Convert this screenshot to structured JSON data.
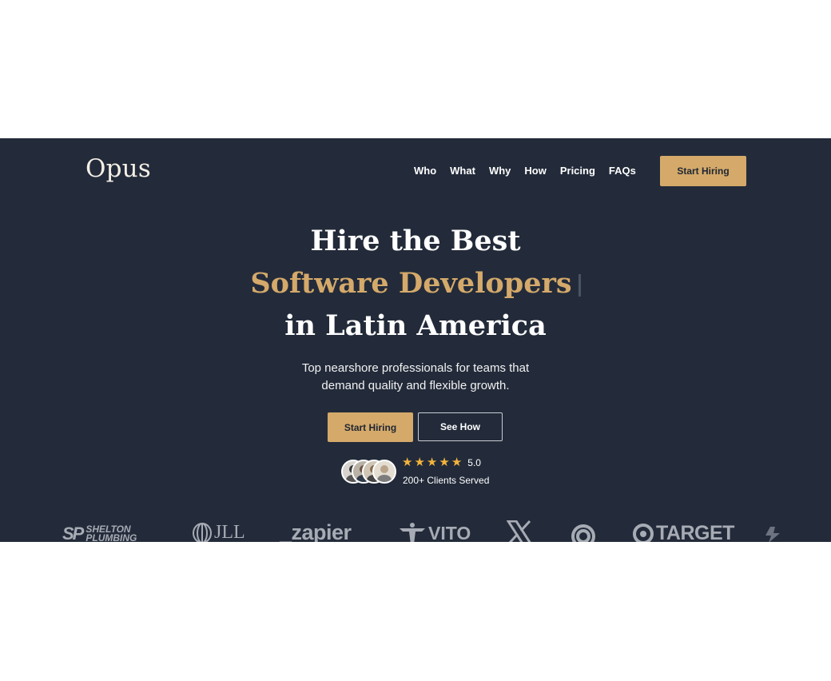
{
  "brand": {
    "name": "Opus"
  },
  "nav": {
    "items": [
      "Who",
      "What",
      "Why",
      "How",
      "Pricing",
      "FAQs"
    ],
    "cta_label": "Start Hiring"
  },
  "hero": {
    "headline_line1": "Hire the Best",
    "headline_line2": "Software Developers",
    "headline_line3": "in Latin America",
    "subtitle_line1": "Top nearshore professionals for teams that",
    "subtitle_line2": "demand quality and flexible growth.",
    "primary_cta": "Start Hiring",
    "secondary_cta": "See How",
    "rating": "5.0",
    "stars": 5,
    "clients_served": "200+ Clients Served"
  },
  "client_logos": [
    {
      "name": "shelton-plumbing",
      "text": "SHELTON PLUMBING",
      "mark": "SP"
    },
    {
      "name": "jll",
      "text": "JLL"
    },
    {
      "name": "zapier",
      "text": "_zapier"
    },
    {
      "name": "vito",
      "text": "VITO"
    },
    {
      "name": "x",
      "text": "X"
    },
    {
      "name": "emblem",
      "text": ""
    },
    {
      "name": "target",
      "text": "TARGET"
    }
  ],
  "colors": {
    "background": "#232b3a",
    "accent": "#d4a96a",
    "text": "#ffffff",
    "logo_gray": "#a7abb4"
  }
}
